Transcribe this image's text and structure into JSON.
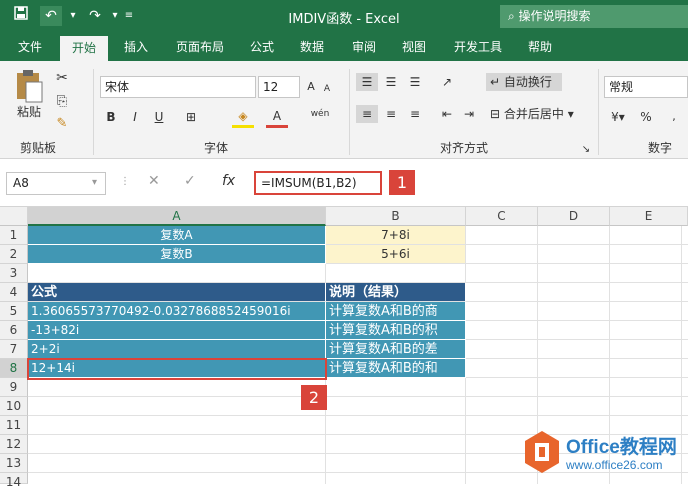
{
  "titlebar": {
    "title": "IMDIV函数 - Excel",
    "search": "操作说明搜索"
  },
  "tabs": [
    "文件",
    "开始",
    "插入",
    "页面布局",
    "公式",
    "数据",
    "审阅",
    "视图",
    "开发工具",
    "帮助"
  ],
  "ribbon": {
    "paste": "粘贴",
    "clipboard": "剪贴板",
    "font_name": "宋体",
    "font_size": "12",
    "bold": "B",
    "italic": "I",
    "underline": "U",
    "wen": "wén",
    "font_group": "字体",
    "wrap": "自动换行",
    "merge": "合并后居中",
    "align_group": "对齐方式",
    "number_format": "常规",
    "percent": "%",
    "number_group": "数字"
  },
  "formula_bar": {
    "name_box": "A8",
    "fx": "fx",
    "formula": "=IMSUM(B1,B2)"
  },
  "callouts": [
    "1",
    "2"
  ],
  "columns": [
    "A",
    "B",
    "C",
    "D",
    "E"
  ],
  "rows": [
    "1",
    "2",
    "3",
    "4",
    "5",
    "6",
    "7",
    "8",
    "9",
    "10",
    "11",
    "12",
    "13",
    "14"
  ],
  "cells": {
    "a1": "复数A",
    "b1": "7+8i",
    "a2": "复数B",
    "b2": "5+6i",
    "a4": "公式",
    "b4": "说明（结果）",
    "a5": "1.36065573770492-0.0327868852459016i",
    "b5": "计算复数A和B的商",
    "a6": "-13+82i",
    "b6": "计算复数A和B的积",
    "a7": "2+2i",
    "b7": "计算复数A和B的差",
    "a8": "12+14i",
    "b8": "计算复数A和B的和"
  },
  "logo": {
    "name": "Office教程网",
    "url": "www.office26.com"
  },
  "colors": {
    "accent": "#217346",
    "teal": "#4197b4",
    "header": "#2e5b8a",
    "yellow": "#fdf4cc",
    "callout": "#d9443a"
  }
}
